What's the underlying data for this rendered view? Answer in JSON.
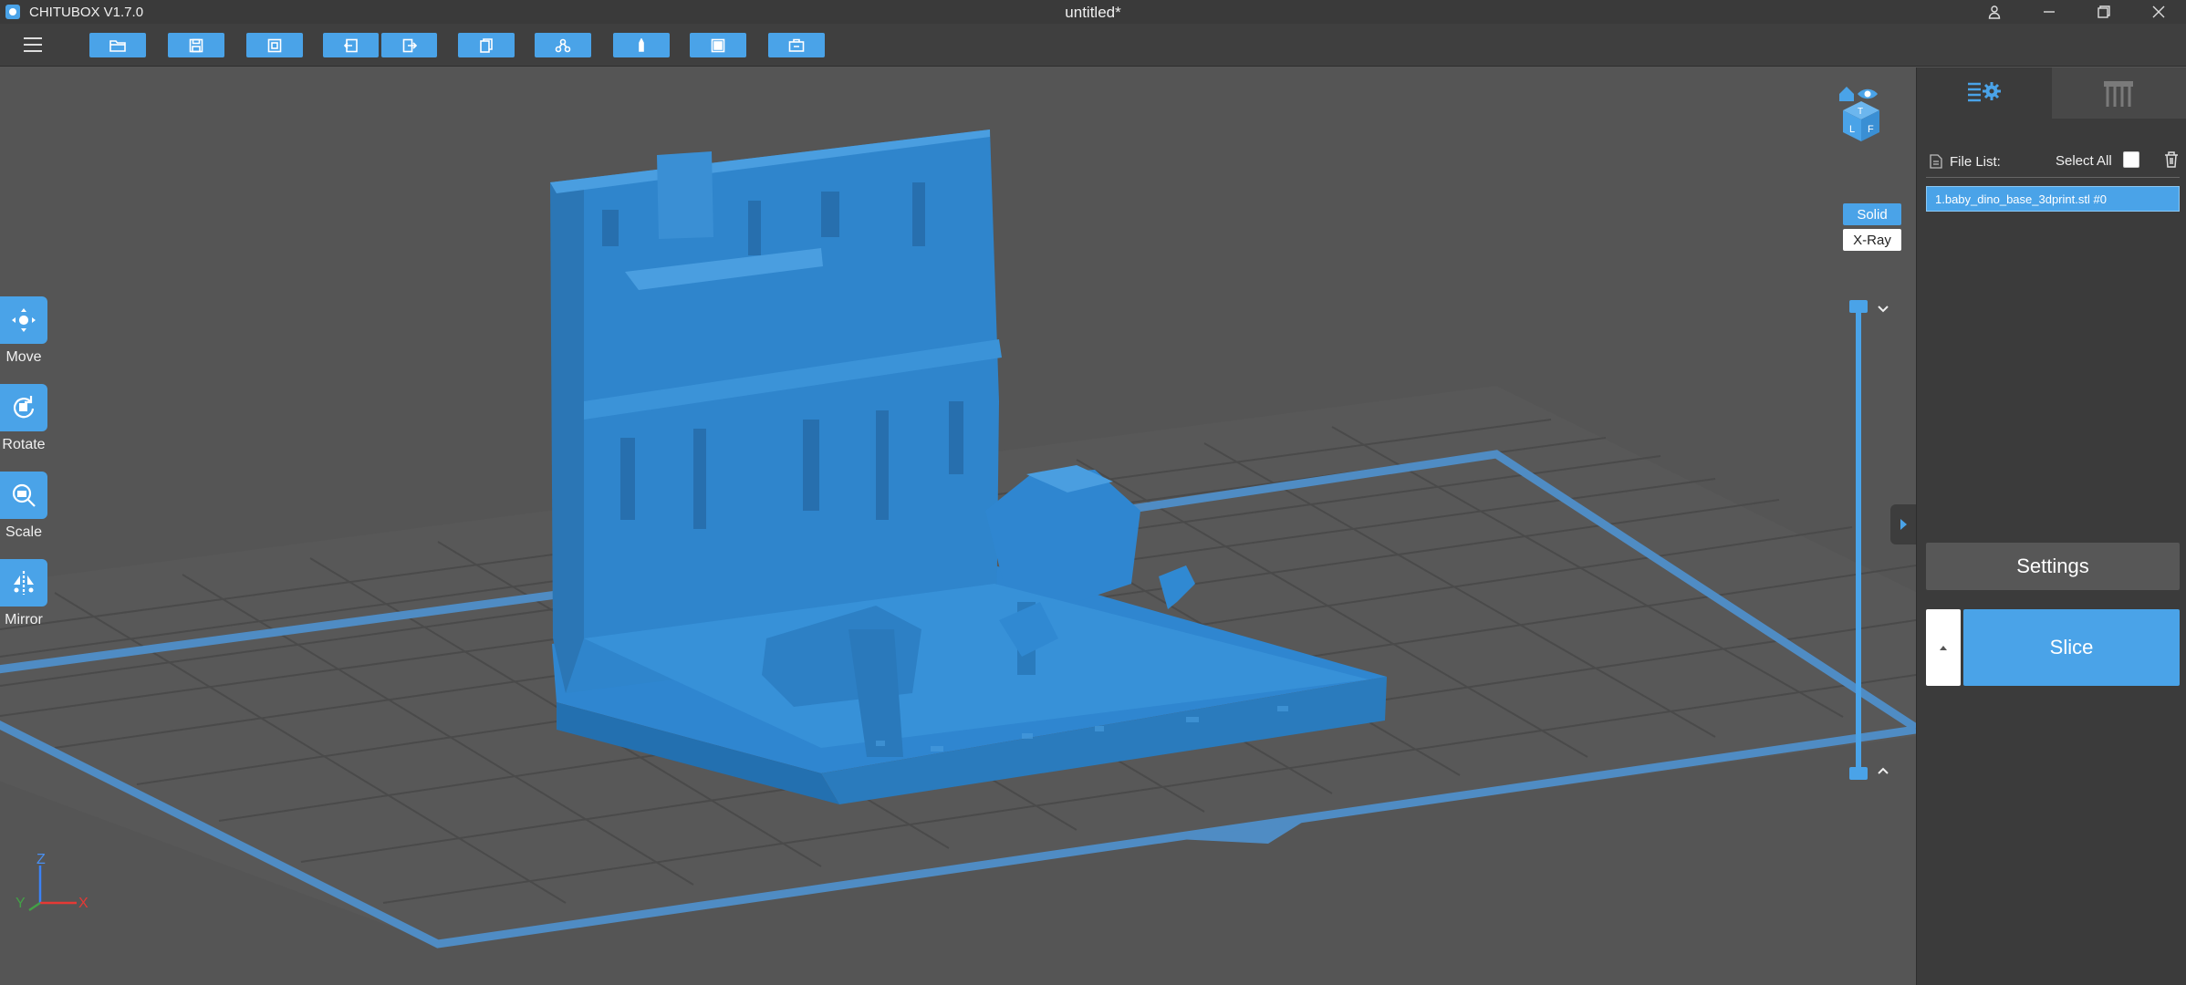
{
  "app": {
    "title": "CHITUBOX V1.7.0",
    "document_title": "untitled*"
  },
  "colors": {
    "accent": "#4aa3e8",
    "model": "#2f7fc0",
    "background": "#555555",
    "panel": "#3b3b3b"
  },
  "toolbar": {
    "buttons": [
      "open-file-icon",
      "save-icon",
      "auto-layout-icon",
      "undo-icon",
      "redo-icon",
      "copy-icon",
      "supports-icon",
      "hollow-icon",
      "slice-preview-icon",
      "export-icon"
    ]
  },
  "tools": {
    "move": "Move",
    "rotate": "Rotate",
    "scale": "Scale",
    "mirror": "Mirror"
  },
  "view_mode": {
    "solid": "Solid",
    "xray": "X-Ray"
  },
  "axis": {
    "x": "X",
    "y": "Y",
    "z": "Z"
  },
  "file_panel": {
    "label": "File List:",
    "select_all": "Select All",
    "files": [
      "1.baby_dino_base_3dprint.stl #0"
    ]
  },
  "actions": {
    "settings": "Settings",
    "slice": "Slice"
  }
}
